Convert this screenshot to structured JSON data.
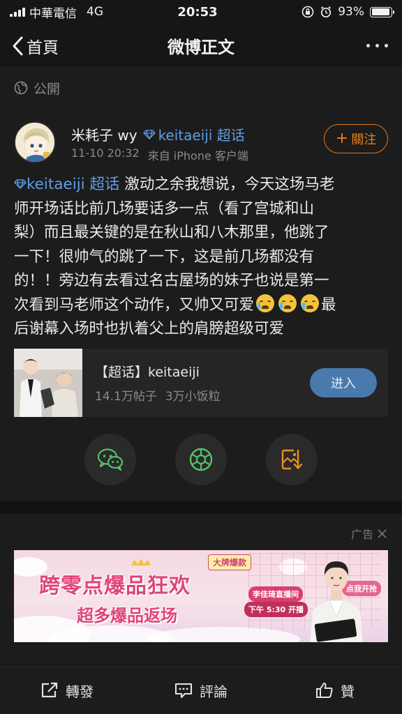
{
  "status_bar": {
    "carrier": "中華電信",
    "network": "4G",
    "time": "20:53",
    "battery": "93%",
    "battery_level": 0.93
  },
  "nav": {
    "back_label": "首頁",
    "title": "微博正文"
  },
  "visibility": "公開",
  "post": {
    "username": "米耗子 wy",
    "topic_name": "keitaeiji 超话",
    "date": "11-10 20:32",
    "source": "來自 iPhone 客户端",
    "follow_label": "關注",
    "body_tag": "keitaeiji 超话",
    "body_line1": "激动之余我想说，今天这场马老",
    "body_line2": "师开场话比前几场要话多一点（看了宫城和山",
    "body_line3": "梨）而且最关键的是在秋山和八木那里，他跳了",
    "body_line4": "一下！很帅气的跳了一下，这是前几场都没有",
    "body_line5": "的！！旁边有去看过名古屋场的妹子也说是第一",
    "body_line6": "次看到马老师这个动作，又帅又可爱",
    "body_line6b": "最",
    "body_line7": "后谢幕入场时也扒着父上的肩膀超级可爱",
    "emoji_name": "crying-face"
  },
  "supertopic_card": {
    "name": "【超话】keitaeiji",
    "posts": "14.1万帖子",
    "members": "3万小饭粒",
    "enter_label": "进入"
  },
  "share_buttons": [
    "wechat-icon",
    "moments-icon",
    "save-image-icon"
  ],
  "ad": {
    "label": "广告",
    "headline": "跨零点爆品狂欢",
    "subline": "超多爆品返场",
    "badge": "大牌爆款",
    "pill1": "李佳琦直播间",
    "pill2": "下午 5:30 开播",
    "pill3": "点我开抢"
  },
  "bottom_bar": {
    "repost": "轉發",
    "comment": "評論",
    "like": "贊"
  },
  "colors": {
    "background": "#161616",
    "surface": "#1c1c1c",
    "link": "#5f9de3",
    "follow_orange": "#e8801f",
    "enter_button": "#4a79ae"
  }
}
